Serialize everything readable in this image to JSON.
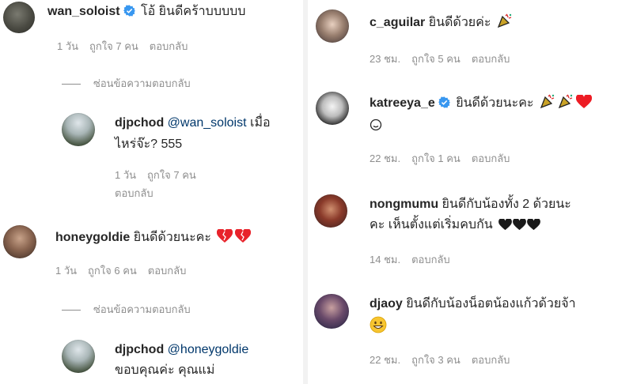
{
  "left": {
    "c1": {
      "user": "wan_soloist",
      "text": "โอ้ ยินดีคร้าบบบบบ",
      "time": "1 วัน",
      "likes": "ถูกใจ 7 คน",
      "reply": "ตอบกลับ"
    },
    "hide1": "ซ่อนข้อความตอบกลับ",
    "r1": {
      "user": "djpchod",
      "mention": "@wan_soloist",
      "text1": "เมื่อ",
      "text2": "ไหร่จ๊ะ? 555",
      "time": "1 วัน",
      "likes": "ถูกใจ 7 คน",
      "reply": "ตอบกลับ"
    },
    "c2": {
      "user": "honeygoldie",
      "text": "ยินดีด้วยนะคะ",
      "time": "1 วัน",
      "likes": "ถูกใจ 6 คน",
      "reply": "ตอบกลับ"
    },
    "hide2": "ซ่อนข้อความตอบกลับ",
    "r2": {
      "user": "djpchod",
      "mention": "@honeygoldie",
      "text": "ขอบคุณค่ะ คุณแม่"
    }
  },
  "right": {
    "c1": {
      "user": "c_aguilar",
      "text": "ยินดีด้วยค่ะ",
      "time": "23 ชม.",
      "likes": "ถูกใจ 5 คน",
      "reply": "ตอบกลับ"
    },
    "c2": {
      "user": "katreeya_e",
      "text": "ยินดีด้วยนะคะ",
      "time": "22 ชม.",
      "likes": "ถูกใจ 1 คน",
      "reply": "ตอบกลับ"
    },
    "c3": {
      "user": "nongmumu",
      "text1": "ยินดีกับน้องทั้ง 2 ด้วยนะ",
      "text2": "คะ เห็นตั้งแต่เริ่มคบกัน",
      "time": "14 ชม.",
      "reply": "ตอบกลับ"
    },
    "c4": {
      "user": "djaoy",
      "text": "ยินดีกับน้องน็อตน้องแก้วด้วยจ้า",
      "time": "22 ชม.",
      "likes": "ถูกใจ 3 คน",
      "reply": "ตอบกลับ"
    }
  },
  "colors": {
    "verified": "#3897f0",
    "meta": "#8e8e8e",
    "mention": "#00376b",
    "heart_red": "#ed1c24"
  }
}
